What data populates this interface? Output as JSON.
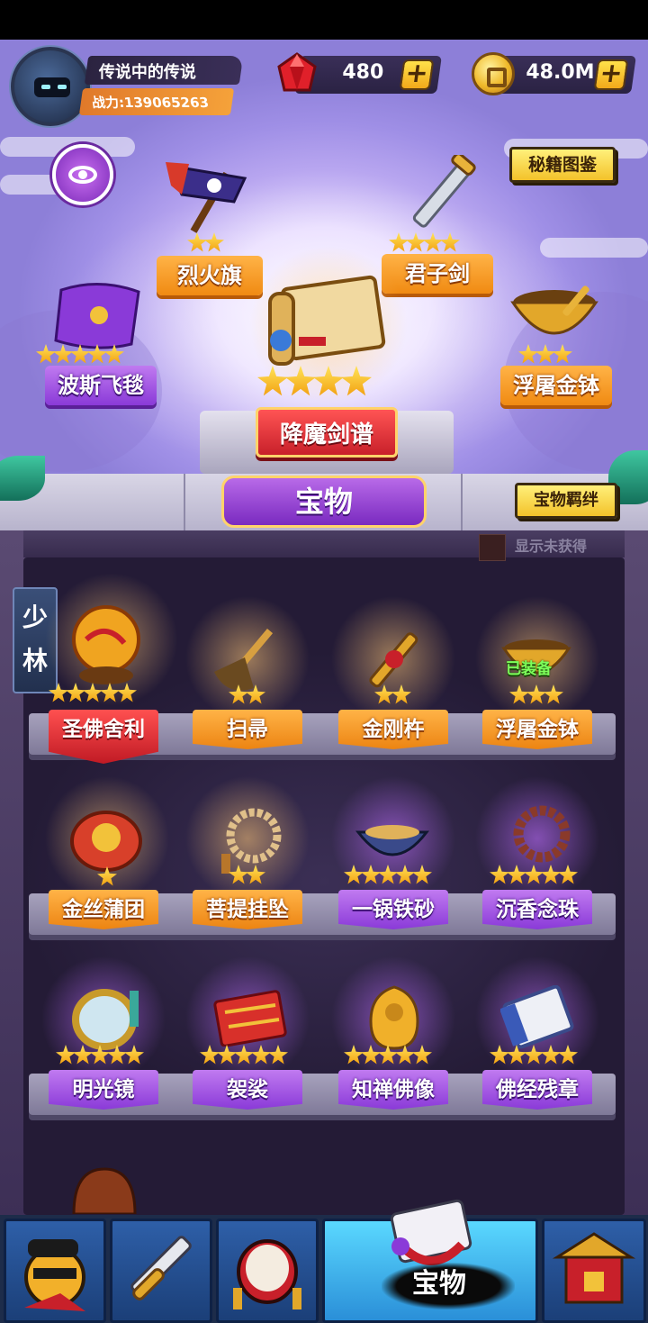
{
  "player": {
    "name": "传说中的传说",
    "power_label": "战力:",
    "power_value": "139065263"
  },
  "currency": {
    "gems": "480",
    "gold": "48.0M",
    "plus": "+"
  },
  "buttons": {
    "codex": "秘籍图鉴",
    "bond": "宝物羁绊",
    "show_unobtained": "显示未获得"
  },
  "showcase": {
    "items": [
      {
        "name": "烈火旗",
        "stars": 2
      },
      {
        "name": "君子剑",
        "stars": 4
      },
      {
        "name": "波斯飞毯",
        "stars": 5
      },
      {
        "name": "浮屠金钵",
        "stars": 3
      },
      {
        "name": "降魔剑谱",
        "stars": 4
      }
    ]
  },
  "section_title": "宝物",
  "sect": "少林",
  "shelves": [
    [
      {
        "name": "圣佛舍利",
        "stars": 5,
        "style": "red"
      },
      {
        "name": "扫帚",
        "stars": 2,
        "style": "orange"
      },
      {
        "name": "金刚杵",
        "stars": 2,
        "style": "orange"
      },
      {
        "name": "浮屠金钵",
        "stars": 3,
        "style": "orange",
        "badge": "已装备"
      }
    ],
    [
      {
        "name": "金丝蒲团",
        "stars": 1,
        "style": "orange"
      },
      {
        "name": "菩提挂坠",
        "stars": 2,
        "style": "orange"
      },
      {
        "name": "一锅铁砂",
        "stars": 5,
        "style": "purple"
      },
      {
        "name": "沉香念珠",
        "stars": 5,
        "style": "purple"
      }
    ],
    [
      {
        "name": "明光镜",
        "stars": 5,
        "style": "purple"
      },
      {
        "name": "袈裟",
        "stars": 5,
        "style": "purple"
      },
      {
        "name": "知禅佛像",
        "stars": 5,
        "style": "purple"
      },
      {
        "name": "佛经残章",
        "stars": 5,
        "style": "purple"
      }
    ]
  ],
  "nav": {
    "active_label": "宝物"
  },
  "icons": [
    "gem-icon",
    "coin-icon",
    "eye-icon",
    "hero-icon",
    "sword-icon",
    "drum-icon",
    "scroll-icon",
    "temple-icon"
  ],
  "colors": {
    "orange": "#f08a12",
    "purple": "#8a3ad8",
    "red": "#c8202a",
    "nav": "#1d2c4a"
  }
}
